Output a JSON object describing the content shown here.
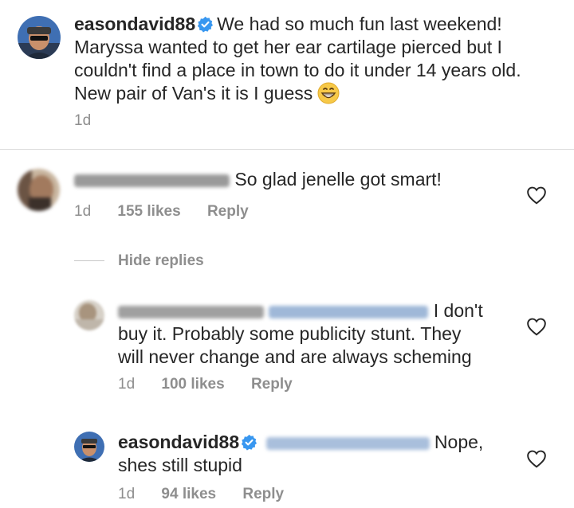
{
  "post": {
    "username": "easondavid88",
    "caption": "We had so much fun last weekend! Maryssa wanted to get her ear cartilage pierced but I couldn't find a place in town to do it under 14 years old. New pair of Van's it is I guess",
    "time": "1d",
    "emoji": "grinning-face-with-smiling-eyes"
  },
  "comments": [
    {
      "text": "So glad jenelle got smart!",
      "time": "1d",
      "likes": "155 likes",
      "reply": "Reply",
      "hide_replies": "Hide replies"
    }
  ],
  "replies": [
    {
      "text_line1": "I don't",
      "text_line2": "buy it. Probably some publicity stunt. They",
      "text_line3": "will never change and are always scheming",
      "time": "1d",
      "likes": "100 likes",
      "reply": "Reply"
    },
    {
      "username": "easondavid88",
      "text_line1": "Nope,",
      "text_line2": "shes still stupid",
      "time": "1d",
      "likes": "94 likes",
      "reply": "Reply"
    }
  ],
  "colors": {
    "verified": "#3897f0",
    "meta": "#8e8e8e",
    "text": "#262626",
    "divider": "#dbdbdb"
  }
}
